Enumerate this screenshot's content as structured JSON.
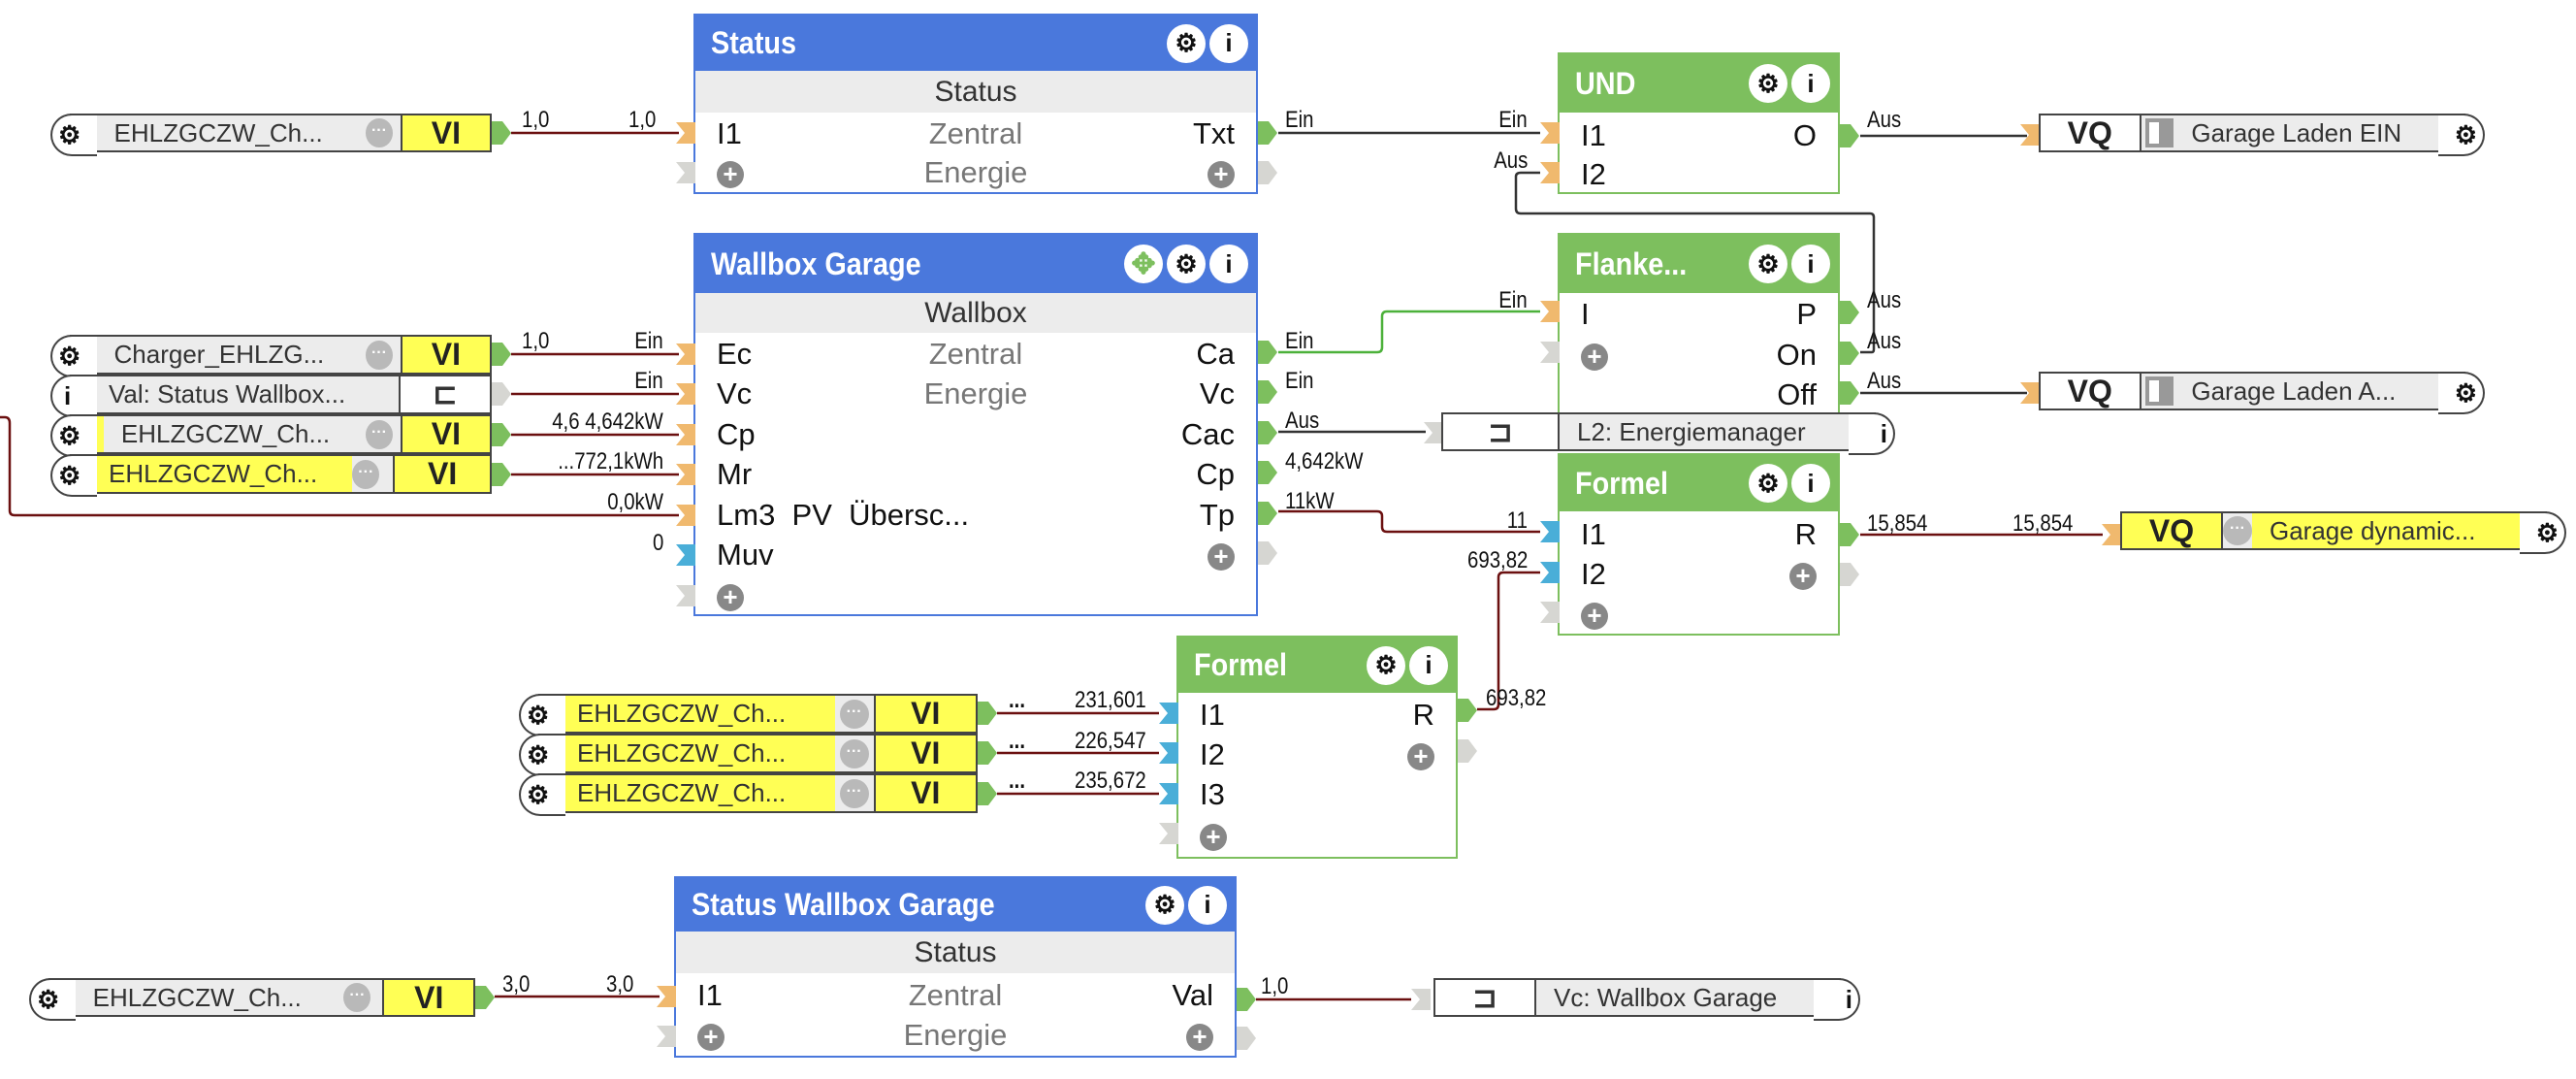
{
  "colors": {
    "block_header_blue": "#4a78dc",
    "block_header_green": "#7dbf5e",
    "input_port_orange": "#f0b96e",
    "input_port_blue": "#4aaed8",
    "output_port_green": "#7dbf5e",
    "wire_dark_red": "#6b1010",
    "wire_green": "#4cb13a",
    "wire_dark": "#333333",
    "vi_yellow": "#ffff55"
  },
  "blocks": {
    "status": {
      "title": "Status",
      "subtitle": "Status",
      "rows": [
        {
          "left": "I1",
          "center": "Zentral",
          "right": "Txt"
        },
        {
          "left": "+",
          "center": "Energie",
          "right": "+"
        }
      ]
    },
    "wallbox_garage": {
      "title": "Wallbox Garage",
      "subtitle": "Wallbox",
      "rows": [
        {
          "left": "Ec",
          "center": "Zentral",
          "right": "Ca"
        },
        {
          "left": "Vc",
          "center": "Energie",
          "right": "Vc"
        },
        {
          "left": "Cp",
          "center": "",
          "right": "Cac"
        },
        {
          "left": "Mr",
          "center": "",
          "right": "Cp"
        },
        {
          "left": "Lm3  PV  Übersc...",
          "center": "",
          "right": "Tp"
        },
        {
          "left": "Muv",
          "center": "",
          "right": "+"
        },
        {
          "left": "+",
          "center": "",
          "right": ""
        }
      ]
    },
    "und": {
      "title": "UND",
      "rows": [
        {
          "left": "I1",
          "right": "O"
        },
        {
          "left": "I2",
          "right": ""
        }
      ]
    },
    "flanke": {
      "title": "Flanke...",
      "rows": [
        {
          "left": "I",
          "right": "P"
        },
        {
          "left": "+",
          "right": "On"
        },
        {
          "left": "",
          "right": "Off"
        }
      ]
    },
    "formel_right": {
      "title": "Formel",
      "rows": [
        {
          "left": "I1",
          "right": "R"
        },
        {
          "left": "I2",
          "right": "+"
        },
        {
          "left": "+",
          "right": ""
        }
      ]
    },
    "formel_lower": {
      "title": "Formel",
      "rows": [
        {
          "left": "I1",
          "right": "R"
        },
        {
          "left": "I2",
          "right": "+"
        },
        {
          "left": "I3",
          "right": ""
        },
        {
          "left": "+",
          "right": ""
        }
      ]
    },
    "status_wallbox_garage": {
      "title": "Status Wallbox Garage",
      "subtitle": "Status",
      "rows": [
        {
          "left": "I1",
          "center": "Zentral",
          "right": "Val"
        },
        {
          "left": "+",
          "center": "Energie",
          "right": "+"
        }
      ]
    }
  },
  "inputs": {
    "vi_top": {
      "label": "EHLZGCZW_Ch...",
      "type": "VI"
    },
    "vi_charger": {
      "label": "Charger_EHLZG...",
      "type": "VI"
    },
    "val_status_wallbox": {
      "label": "Val: Status Wallbox...",
      "icon": "connector-icon"
    },
    "vi_cp": {
      "label": "EHLZGCZW_Ch...",
      "type": "VI"
    },
    "vi_mr": {
      "label": "EHLZGCZW_Ch...",
      "type": "VI"
    },
    "vi_f1": {
      "label": "EHLZGCZW_Ch...",
      "type": "VI"
    },
    "vi_f2": {
      "label": "EHLZGCZW_Ch...",
      "type": "VI"
    },
    "vi_f3": {
      "label": "EHLZGCZW_Ch...",
      "type": "VI"
    },
    "vi_bottom": {
      "label": "EHLZGCZW_Ch...",
      "type": "VI"
    }
  },
  "outputs": {
    "vq_laden_ein": {
      "label": "Garage Laden EIN",
      "type": "VQ"
    },
    "vq_laden_aus": {
      "label": "Garage Laden A...",
      "type": "VQ"
    },
    "vq_dynamic": {
      "label": "Garage dynamic...",
      "type": "VQ"
    },
    "l2_energiemanager": {
      "label": "L2: Energiemanager"
    },
    "vc_wallbox_garage": {
      "label": "Vc: Wallbox Garage"
    }
  },
  "wire_labels": {
    "top_vi_out": "1,0",
    "status_i1_in": "1,0",
    "status_txt_out": "Ein",
    "und_i1_in": "Ein",
    "und_i2_in": "Aus",
    "und_o_out": "Aus",
    "charger_out": "1,0",
    "ec_in": "Ein",
    "vc_in": "Ein",
    "cp_in": "4,6 4,642kW",
    "mr_in": "...772,1kWh",
    "lm3_in": "0,0kW",
    "muv_in": "0",
    "ca_out": "Ein",
    "vc_out": "Ein",
    "cac_out": "Aus",
    "cp_out": "4,642kW",
    "tp_out": "11kW",
    "flanke_i_in": "Ein",
    "flanke_p_out": "Aus",
    "flanke_on_out": "Aus",
    "flanke_off_out": "Aus",
    "formel_i1_in": "11",
    "formel_i2_in": "693,82",
    "formel_r_out": "15,854",
    "vq_dynamic_in": "15,854",
    "f1_dots": "...",
    "f1_in": "231,601",
    "f2_dots": "...",
    "f2_in": "226,547",
    "f3_dots": "...",
    "f3_in": "235,672",
    "formel_lower_r_out": "693,82",
    "bottom_vi_out": "3,0",
    "swg_i1_in": "3,0",
    "swg_val_out": "1,0"
  },
  "icons": {
    "gear": "⚙",
    "info": "i",
    "move": "✥",
    "plus": "+",
    "dots": "···"
  }
}
